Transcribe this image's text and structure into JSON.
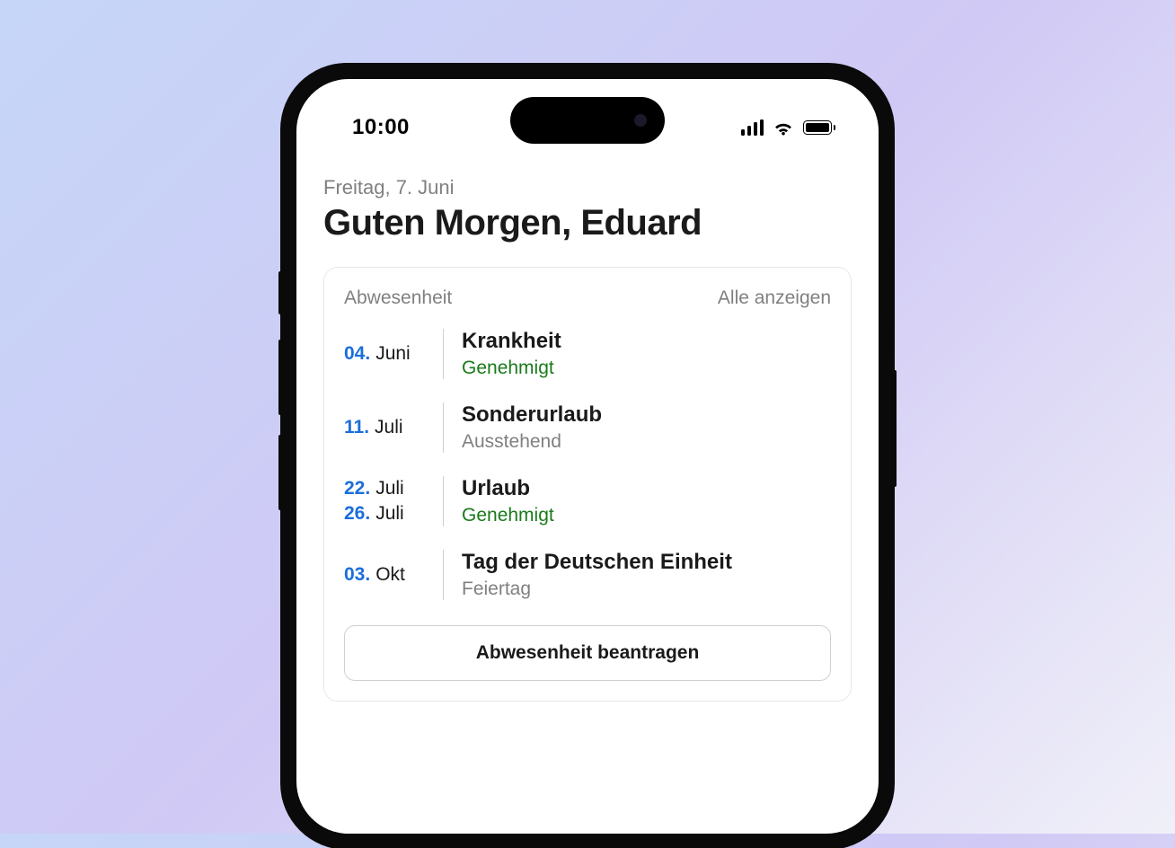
{
  "statusBar": {
    "time": "10:00"
  },
  "header": {
    "date": "Freitag, 7. Juni",
    "greeting": "Guten Morgen, Eduard"
  },
  "absenceCard": {
    "title": "Abwesenheit",
    "showAllLabel": "Alle anzeigen",
    "items": [
      {
        "dates": [
          {
            "day": "04.",
            "month": "Juni"
          }
        ],
        "type": "Krankheit",
        "status": "Genehmigt",
        "statusClass": "status-approved"
      },
      {
        "dates": [
          {
            "day": "11.",
            "month": "Juli"
          }
        ],
        "type": "Sonderurlaub",
        "status": "Ausstehend",
        "statusClass": "status-pending"
      },
      {
        "dates": [
          {
            "day": "22.",
            "month": "Juli"
          },
          {
            "day": "26.",
            "month": "Juli"
          }
        ],
        "type": "Urlaub",
        "status": "Genehmigt",
        "statusClass": "status-approved"
      },
      {
        "dates": [
          {
            "day": "03.",
            "month": "Okt"
          }
        ],
        "type": "Tag der Deutschen Einheit",
        "status": "Feiertag",
        "statusClass": "status-holiday"
      }
    ],
    "requestButtonLabel": "Abwesenheit beantragen"
  }
}
